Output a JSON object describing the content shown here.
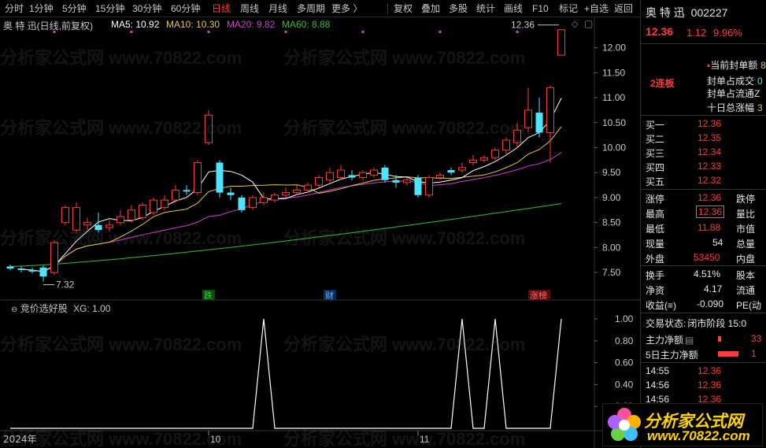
{
  "toolbar": {
    "periods": [
      "分时",
      "1分钟",
      "5分钟",
      "15分钟",
      "30分钟",
      "60分钟",
      "日线",
      "周线",
      "月线",
      "多周期",
      "更多 〉"
    ],
    "active_period": "日线",
    "tools": [
      "复权",
      "叠加",
      "多股",
      "统计",
      "画线",
      "F10",
      "标记",
      "+自选",
      "返回"
    ]
  },
  "main_chart": {
    "stock_title": "奥 特 迅(日线,前复权)",
    "ma5": "MA5: 10.92",
    "ma10": "MA10: 10.30",
    "ma20": "MA20: 9.82",
    "ma60": "MA60: 8.88",
    "price_ticks": [
      "12.00",
      "11.50",
      "11.00",
      "10.50",
      "10.00",
      "9.50",
      "9.00",
      "8.50",
      "8.00",
      "7.50"
    ],
    "high_marker": "12.36",
    "low_marker": "7.32",
    "event_markers": [
      "跌",
      "财",
      "涨榜"
    ],
    "colors": {
      "up": "#ff3a3a",
      "down": "#4fe3ff",
      "ma5": "#ffffff",
      "ma10": "#e6c84a",
      "ma20": "#d040d0",
      "ma60": "#33c033"
    }
  },
  "indicator": {
    "name": "竞价选好股",
    "value": "XG: 1.00",
    "ticks": [
      "1.00",
      "0.80",
      "0.60",
      "0.40",
      "0.20"
    ]
  },
  "time_axis": [
    "2024年",
    "10",
    "11"
  ],
  "chart_data": {
    "type": "candlestick",
    "y_range": [
      7.25,
      12.45
    ],
    "candles": [
      {
        "o": 7.62,
        "c": 7.58,
        "h": 7.66,
        "l": 7.55
      },
      {
        "o": 7.58,
        "c": 7.55,
        "h": 7.62,
        "l": 7.5
      },
      {
        "o": 7.55,
        "c": 7.52,
        "h": 7.6,
        "l": 7.48
      },
      {
        "o": 7.6,
        "c": 7.42,
        "h": 7.64,
        "l": 7.32
      },
      {
        "o": 7.5,
        "c": 8.1,
        "h": 8.15,
        "l": 7.45
      },
      {
        "o": 8.5,
        "c": 8.8,
        "h": 8.85,
        "l": 8.45
      },
      {
        "o": 8.35,
        "c": 8.8,
        "h": 8.9,
        "l": 8.3
      },
      {
        "o": 8.45,
        "c": 8.5,
        "h": 8.6,
        "l": 8.35
      },
      {
        "o": 8.45,
        "c": 8.35,
        "h": 8.7,
        "l": 8.3
      },
      {
        "o": 8.4,
        "c": 8.45,
        "h": 8.55,
        "l": 8.32
      },
      {
        "o": 8.5,
        "c": 8.62,
        "h": 8.75,
        "l": 8.45
      },
      {
        "o": 8.55,
        "c": 8.75,
        "h": 8.85,
        "l": 8.5
      },
      {
        "o": 8.6,
        "c": 8.85,
        "h": 8.9,
        "l": 8.55
      },
      {
        "o": 8.7,
        "c": 8.95,
        "h": 9.0,
        "l": 8.65
      },
      {
        "o": 8.8,
        "c": 8.95,
        "h": 9.05,
        "l": 8.75
      },
      {
        "o": 8.95,
        "c": 9.15,
        "h": 9.25,
        "l": 8.9
      },
      {
        "o": 9.15,
        "c": 9.12,
        "h": 9.25,
        "l": 9.05
      },
      {
        "o": 9.1,
        "c": 9.7,
        "h": 9.75,
        "l": 9.05
      },
      {
        "o": 10.1,
        "c": 10.65,
        "h": 10.75,
        "l": 10.05
      },
      {
        "o": 9.7,
        "c": 9.1,
        "h": 9.75,
        "l": 9.0
      },
      {
        "o": 9.1,
        "c": 9.05,
        "h": 9.2,
        "l": 8.95
      },
      {
        "o": 9.0,
        "c": 8.75,
        "h": 9.05,
        "l": 8.7
      },
      {
        "o": 8.8,
        "c": 9.0,
        "h": 9.05,
        "l": 8.75
      },
      {
        "o": 8.9,
        "c": 9.0,
        "h": 9.1,
        "l": 8.85
      },
      {
        "o": 8.95,
        "c": 9.05,
        "h": 9.1,
        "l": 8.9
      },
      {
        "o": 9.05,
        "c": 9.1,
        "h": 9.2,
        "l": 9.0
      },
      {
        "o": 9.1,
        "c": 9.15,
        "h": 9.25,
        "l": 9.05
      },
      {
        "o": 9.15,
        "c": 9.25,
        "h": 9.3,
        "l": 9.1
      },
      {
        "o": 9.25,
        "c": 9.4,
        "h": 9.45,
        "l": 9.2
      },
      {
        "o": 9.35,
        "c": 9.5,
        "h": 9.6,
        "l": 9.3
      },
      {
        "o": 9.4,
        "c": 9.55,
        "h": 9.65,
        "l": 9.35
      },
      {
        "o": 9.45,
        "c": 9.4,
        "h": 9.55,
        "l": 9.35
      },
      {
        "o": 9.4,
        "c": 9.5,
        "h": 9.55,
        "l": 9.35
      },
      {
        "o": 9.45,
        "c": 9.55,
        "h": 9.6,
        "l": 9.4
      },
      {
        "o": 9.6,
        "c": 9.35,
        "h": 9.65,
        "l": 9.3
      },
      {
        "o": 9.35,
        "c": 9.3,
        "h": 9.45,
        "l": 9.2
      },
      {
        "o": 9.3,
        "c": 9.35,
        "h": 9.4,
        "l": 9.25
      },
      {
        "o": 9.4,
        "c": 9.05,
        "h": 9.45,
        "l": 9.0
      },
      {
        "o": 9.05,
        "c": 9.4,
        "h": 9.45,
        "l": 9.0
      },
      {
        "o": 9.4,
        "c": 9.45,
        "h": 9.5,
        "l": 9.35
      },
      {
        "o": 9.55,
        "c": 9.5,
        "h": 9.6,
        "l": 9.45
      },
      {
        "o": 9.55,
        "c": 9.6,
        "h": 9.7,
        "l": 9.5
      },
      {
        "o": 9.7,
        "c": 9.75,
        "h": 9.85,
        "l": 9.65
      },
      {
        "o": 9.75,
        "c": 9.8,
        "h": 9.85,
        "l": 9.7
      },
      {
        "o": 9.8,
        "c": 9.95,
        "h": 10.0,
        "l": 9.75
      },
      {
        "o": 9.95,
        "c": 10.15,
        "h": 10.2,
        "l": 9.85
      },
      {
        "o": 10.1,
        "c": 10.35,
        "h": 10.5,
        "l": 10.0
      },
      {
        "o": 10.4,
        "c": 10.75,
        "h": 11.2,
        "l": 10.3
      },
      {
        "o": 10.7,
        "c": 10.3,
        "h": 11.0,
        "l": 10.2
      },
      {
        "o": 10.3,
        "c": 11.2,
        "h": 11.25,
        "l": 9.7
      },
      {
        "o": 11.85,
        "c": 12.36,
        "h": 12.36,
        "l": 11.88
      }
    ],
    "indicator_values": [
      0,
      0,
      0,
      0,
      0,
      0,
      0,
      0,
      0,
      0,
      0,
      0,
      0,
      0,
      0,
      0,
      0,
      0,
      0,
      0,
      0,
      0,
      0,
      1,
      0,
      0,
      0,
      0,
      0,
      0,
      0,
      0,
      0,
      0,
      0,
      0,
      0,
      0,
      0,
      0,
      0,
      1,
      0,
      0,
      1,
      0,
      0,
      0,
      0,
      0,
      1
    ]
  },
  "quote": {
    "name": "奥 特 迅",
    "code": "002227",
    "price": "12.36",
    "change": "1.12",
    "change_pct": "9.96%",
    "limit_badge": "2连板",
    "seal_labels": [
      "当前封单额",
      "封单占成交",
      "封单占流通Z",
      "十日总涨幅"
    ],
    "seal_values": [
      "8",
      "0",
      "",
      "3"
    ],
    "bids": [
      {
        "label": "买一",
        "price": "12.36"
      },
      {
        "label": "买二",
        "price": "12.35"
      },
      {
        "label": "买三",
        "price": "12.34"
      },
      {
        "label": "买四",
        "price": "12.33"
      },
      {
        "label": "买五",
        "price": "12.32"
      }
    ],
    "stats": [
      {
        "label": "涨停",
        "value": "12.36",
        "label2": "跌停"
      },
      {
        "label": "最高",
        "value": "12.36",
        "label2": "量比"
      },
      {
        "label": "最低",
        "value": "11.88",
        "label2": "市值"
      },
      {
        "label": "现量",
        "value": "54",
        "label2": "总量"
      },
      {
        "label": "外盘",
        "value": "53450",
        "label2": "内盘"
      }
    ],
    "stats2": [
      {
        "label": "换手",
        "value": "4.51%",
        "label2": "股本"
      },
      {
        "label": "净资",
        "value": "4.17",
        "label2": "流通"
      },
      {
        "label": "收益(≡)",
        "value": "-0.090",
        "label2": "PE(动"
      }
    ],
    "trade_status_label": "交易状态:",
    "trade_status": "闭市阶段 15:0",
    "main_flow_label": "主力净额",
    "main_flow_value": "33",
    "main_flow5_label": "5日主力净额",
    "main_flow5_value": "1",
    "ticks": [
      {
        "time": "14:55",
        "price": "12.36"
      },
      {
        "time": "14:56",
        "price": "12.36"
      },
      {
        "time": "14:56",
        "price": "12.36"
      }
    ]
  },
  "watermark": "分析家公式网 www.70822.com",
  "logo": {
    "text": "分析家公式网",
    "url": "www.70822.com"
  }
}
